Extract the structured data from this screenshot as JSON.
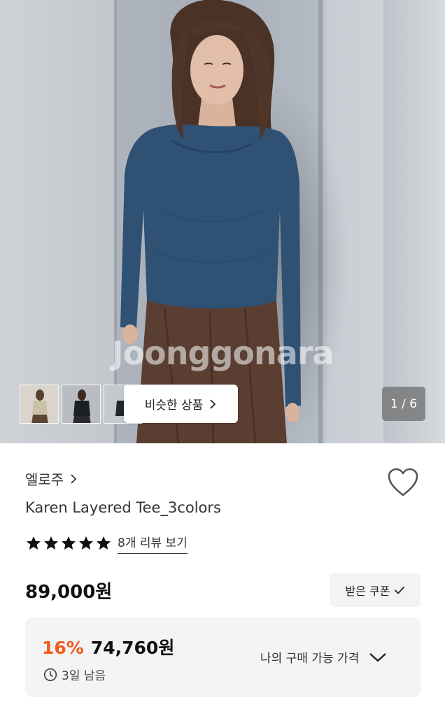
{
  "hero": {
    "watermark": "Joonggonara",
    "similar_button_label": "비슷한 상품",
    "page_counter": "1 / 6",
    "thumbnail_count": 3
  },
  "product": {
    "brand": "엘로주",
    "title": "Karen Layered Tee_3colors",
    "rating_stars": 5,
    "review_link": "8개 리뷰 보기",
    "price": "89,000원",
    "coupon_button_label": "받은 쿠폰"
  },
  "discount": {
    "rate": "16%",
    "price": "74,760원",
    "time_left": "3일 남음",
    "my_price_label": "나의 구매 가능 가격"
  },
  "colors": {
    "accent_orange": "#f05a1a",
    "box_bg": "#f4f4f6",
    "coupon_bg": "#f4f2f4"
  }
}
